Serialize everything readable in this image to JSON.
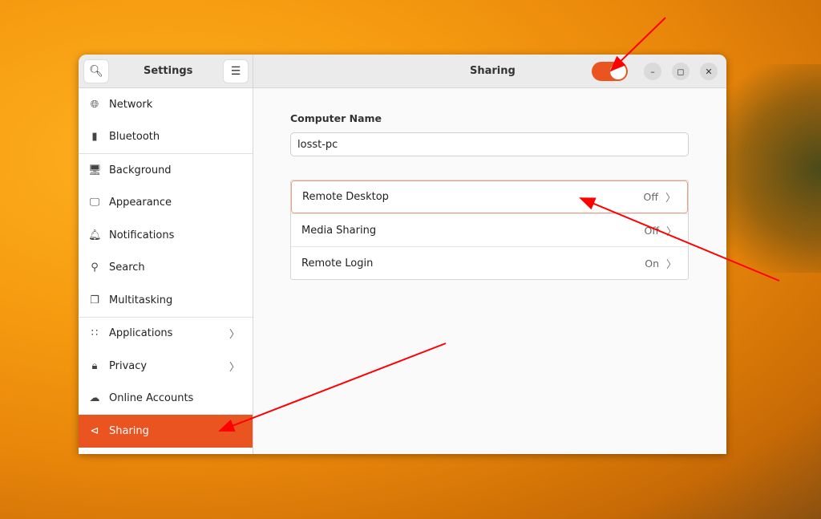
{
  "sidebar": {
    "title": "Settings",
    "search_icon": "search-icon",
    "menu_icon": "hamburger-menu-icon",
    "items": [
      {
        "label": "Network",
        "icon": "globe-icon"
      },
      {
        "label": "Bluetooth",
        "icon": "bluetooth-icon"
      },
      {
        "label": "Background",
        "icon": "background-icon"
      },
      {
        "label": "Appearance",
        "icon": "appearance-icon"
      },
      {
        "label": "Notifications",
        "icon": "bell-icon"
      },
      {
        "label": "Search",
        "icon": "search-icon"
      },
      {
        "label": "Multitasking",
        "icon": "multitasking-icon"
      },
      {
        "label": "Applications",
        "icon": "grid-icon"
      },
      {
        "label": "Privacy",
        "icon": "lock-icon"
      },
      {
        "label": "Online Accounts",
        "icon": "cloud-icon"
      },
      {
        "label": "Sharing",
        "icon": "share-icon",
        "selected": true
      }
    ]
  },
  "header": {
    "title": "Sharing",
    "sharing_enabled": true
  },
  "main": {
    "computer_name_label": "Computer Name",
    "computer_name_value": "losst-pc",
    "rows": [
      {
        "label": "Remote Desktop",
        "status": "Off"
      },
      {
        "label": "Media Sharing",
        "status": "Off"
      },
      {
        "label": "Remote Login",
        "status": "On"
      }
    ]
  },
  "colors": {
    "accent": "#e95420",
    "annotation_arrow": "#ff0000"
  }
}
